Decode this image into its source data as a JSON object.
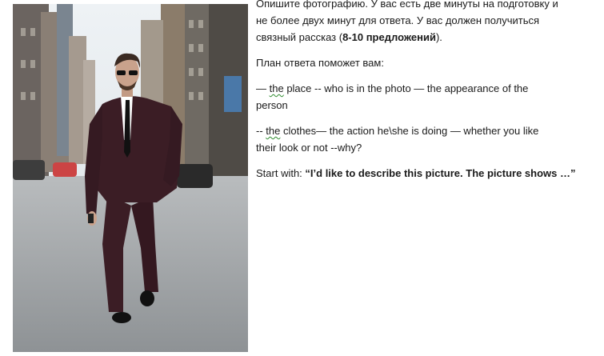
{
  "photo": {
    "description_icon": "man-in-suit-photo"
  },
  "instructions": {
    "line1": "Опишите фотографию. У вас есть две минуты на подготовку и",
    "line2": "не более двух минут для ответа. У вас должен получиться",
    "line3_pre": "связный рассказ (",
    "line3_bold": "8-10 предложений",
    "line3_post": ")."
  },
  "plan_intro": "План ответа поможет вам:",
  "plan_line1": {
    "prefix": "— ",
    "the": "the",
    "rest": " place --  who is in the photo — the appearance of the",
    "cont": "person"
  },
  "plan_line2": {
    "prefix": "-- ",
    "the": "the",
    "rest": " clothes— the action he\\she is doing  — whether you like",
    "cont": "their look or not  --why?"
  },
  "start": {
    "label": "Start with: ",
    "quote": "“I’d like to describe this picture. The picture shows …”"
  },
  "colors": {
    "suit": "#3b1d25",
    "shirt": "#ffffff",
    "road": "#9a9ea1",
    "sky": "#e8eef2"
  }
}
